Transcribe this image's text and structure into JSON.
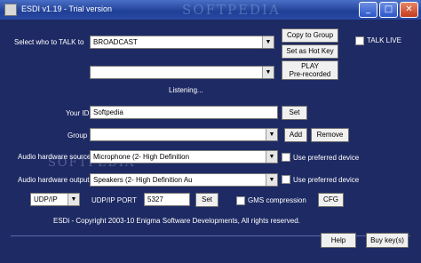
{
  "window": {
    "title": "ESDI v1.19 - Trial version",
    "watermark": "SOFTPEDIA",
    "controls": {
      "minimize": "_",
      "maximize": "□",
      "close": "✕"
    }
  },
  "talk": {
    "label": "Select who to TALK to",
    "selected": "BROADCAST",
    "copy_to_group": "Copy to Group",
    "set_hot_key": "Set as Hot Key",
    "talk_live_label": "TALK LIVE",
    "talk_live_checked": false
  },
  "prerecorded": {
    "selected": "",
    "play_line1": "PLAY",
    "play_line2": "Pre-recorded"
  },
  "status": "Listening...",
  "your_id": {
    "label": "Your ID",
    "value": "Softpedia",
    "set": "Set"
  },
  "group": {
    "label": "Group",
    "selected": "",
    "add": "Add",
    "remove": "Remove"
  },
  "audio_source": {
    "label": "Audio hardware source",
    "selected": "Microphone (2- High Definition",
    "preferred_label": "Use preferred device",
    "preferred_checked": false
  },
  "audio_output": {
    "label": "Audio hardware output",
    "selected": "Speakers (2- High Definition Au",
    "preferred_label": "Use preferred device",
    "preferred_checked": false
  },
  "network": {
    "protocol": "UDP/IP",
    "port_label": "UDP/IP PORT",
    "port_value": "5327",
    "set": "Set",
    "gsm_label": "GMS compression",
    "gsm_checked": false,
    "cfg": "CFG"
  },
  "footer": {
    "copyright": "ESDi - Copyright 2003-10 Enigma Software Developments, All rights reserved.",
    "help": "Help",
    "buy": "Buy key(s)"
  },
  "icons": {
    "arrow": "▼"
  }
}
